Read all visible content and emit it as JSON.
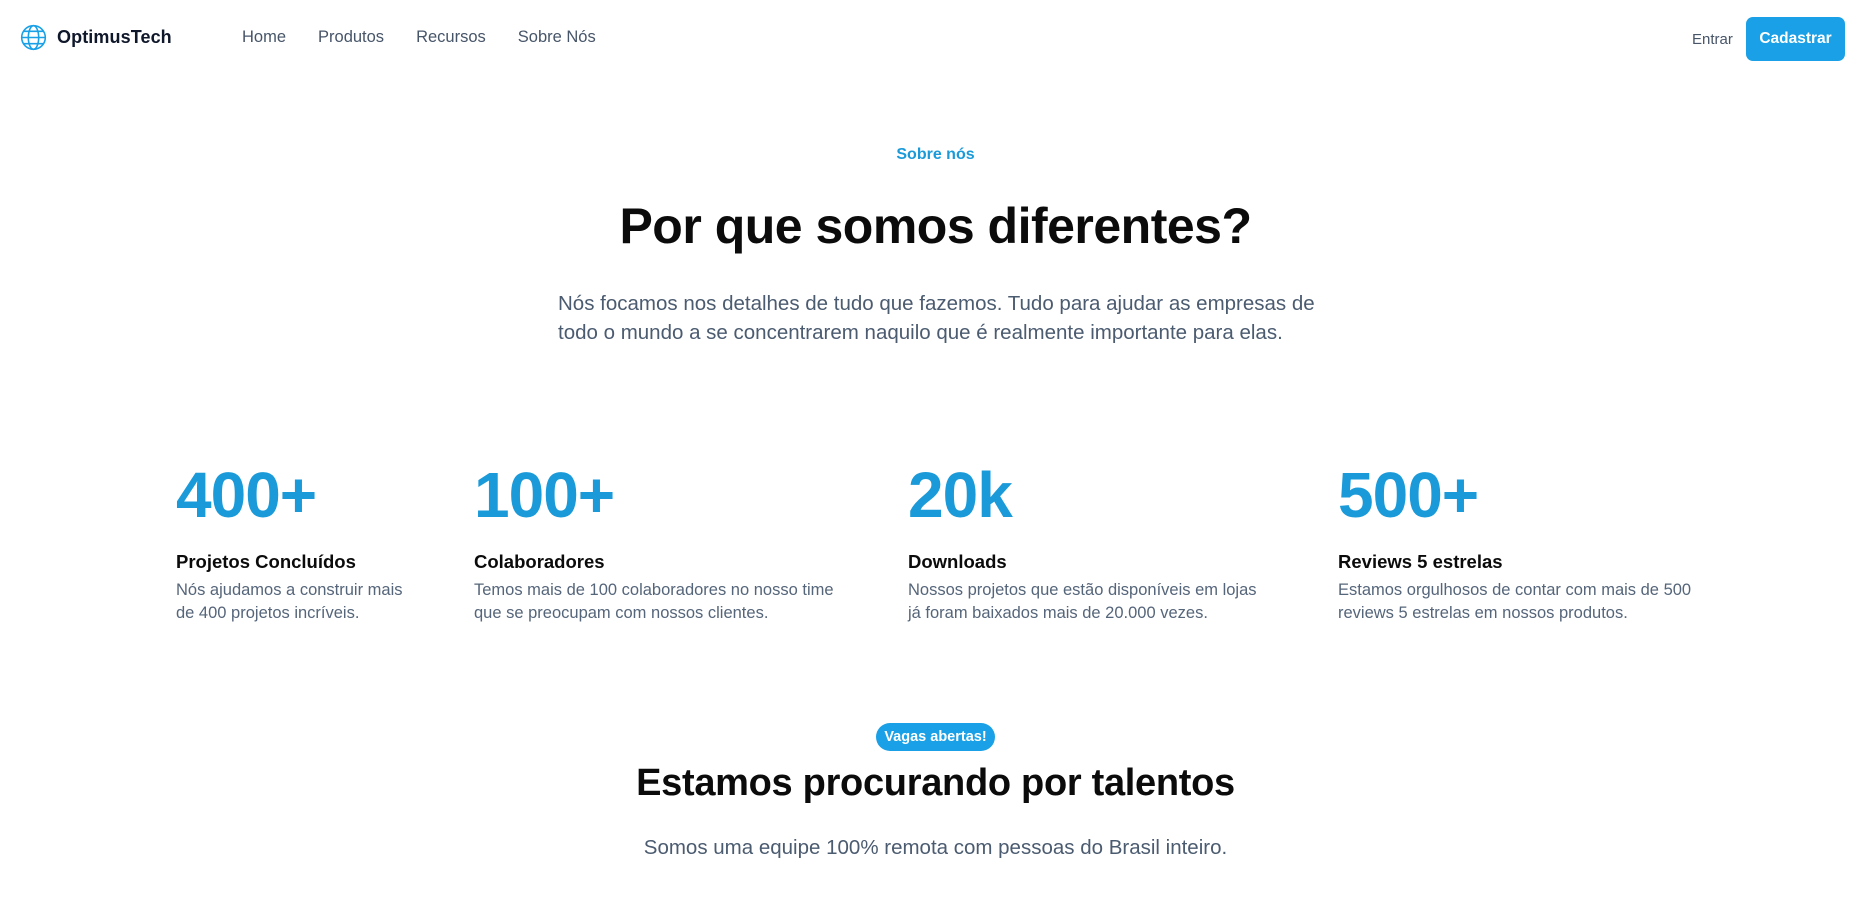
{
  "brand": {
    "name": "OptimusTech",
    "icon": "globe-icon",
    "accent": "#1aa0e6"
  },
  "nav": {
    "items": [
      {
        "label": "Home"
      },
      {
        "label": "Produtos"
      },
      {
        "label": "Recursos"
      },
      {
        "label": "Sobre Nós"
      }
    ],
    "login_label": "Entrar",
    "signup_label": "Cadastrar"
  },
  "about": {
    "eyebrow": "Sobre nós",
    "title": "Por que somos diferentes?",
    "lead_line1": "Nós focamos nos detalhes de tudo que fazemos. Tudo para ajudar as empresas de",
    "lead_line2": "todo o mundo a se concentrarem naquilo que é realmente importante para elas."
  },
  "stats": [
    {
      "value": "400+",
      "title": "Projetos Concluídos",
      "desc_line1": "Nós ajudamos a construir mais",
      "desc_line2": "de 400 projetos incríveis."
    },
    {
      "value": "100+",
      "title": "Colaboradores",
      "desc_line1": "Temos mais de 100 colaboradores no nosso time",
      "desc_line2": "que se preocupam com nossos clientes."
    },
    {
      "value": "20k",
      "title": "Downloads",
      "desc_line1": "Nossos projetos que estão disponíveis em lojas",
      "desc_line2": "já foram baixados mais de 20.000 vezes."
    },
    {
      "value": "500+",
      "title": "Reviews 5 estrelas",
      "desc_line1": "Estamos orgulhosos de contar com mais de 500",
      "desc_line2": "reviews 5 estrelas em nossos produtos."
    }
  ],
  "careers": {
    "badge": "Vagas abertas!",
    "title": "Estamos procurando por talentos",
    "desc": "Somos uma equipe 100% remota com pessoas do Brasil inteiro."
  }
}
